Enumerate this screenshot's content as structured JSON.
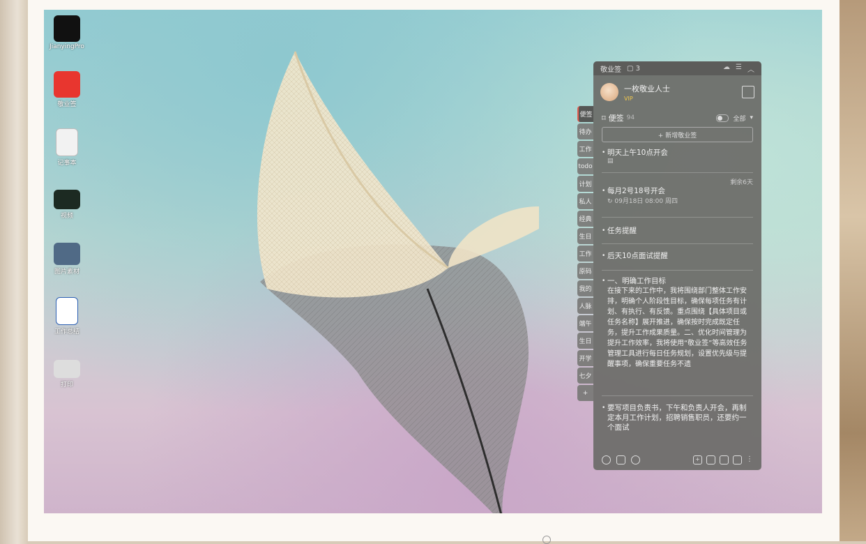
{
  "desktop_icons": [
    {
      "label": "JianyingPro",
      "icon": "jianying-app-icon"
    },
    {
      "label": "敬业签",
      "icon": "jingyeqian-app-icon"
    },
    {
      "label": "记事本",
      "icon": "notepad-file-icon"
    },
    {
      "label": "视频",
      "icon": "video-file-icon"
    },
    {
      "label": "图片素材",
      "icon": "image-file-icon"
    },
    {
      "label": "工作总结",
      "icon": "word-document-icon"
    },
    {
      "label": "打印",
      "icon": "printer-icon"
    }
  ],
  "widget": {
    "app_name": "敬业签",
    "badge_count": "3",
    "profile": {
      "name": "一枚敬业人士",
      "vip": "VIP"
    },
    "section": {
      "title": "便签",
      "count": "94",
      "filter": "全部"
    },
    "add_note": "+ 新增敬业签",
    "tabs": [
      "便签",
      "待办",
      "工作",
      "todo",
      "计划",
      "私人",
      "经典",
      "生日",
      "工作",
      "原码",
      "我的",
      "人脉",
      "端午",
      "生日",
      "开学",
      "七夕",
      "+"
    ],
    "notes": [
      {
        "title": "明天上午10点开会"
      },
      {
        "meta": "剩余6天",
        "title": "每月2号18号开会",
        "sub": "09月18日 08:00 周四"
      },
      {
        "title": "任务提醒"
      },
      {
        "title": "后天10点面试提醒"
      },
      {
        "title": "一、明确工作目标",
        "body": "在接下来的工作中，我将围绕部门整体工作安排，明确个人阶段性目标，确保每项任务有计划、有执行、有反馈。重点围绕【具体项目或任务名称】展开推进，确保按时完成既定任务，提升工作成果质量。二、优化时间管理为提升工作效率，我将使用“敬业签”等高效任务管理工具进行每日任务规划，设置优先级与提醒事项，确保重要任务不遗"
      },
      {
        "title": "要写项目负责书，下午和负责人开会，再制定本月工作计划，招聘销售职员，还要约一个面试"
      }
    ]
  },
  "colors": {
    "accent": "#e25b4e",
    "widget_bg": "#6c6c68"
  }
}
